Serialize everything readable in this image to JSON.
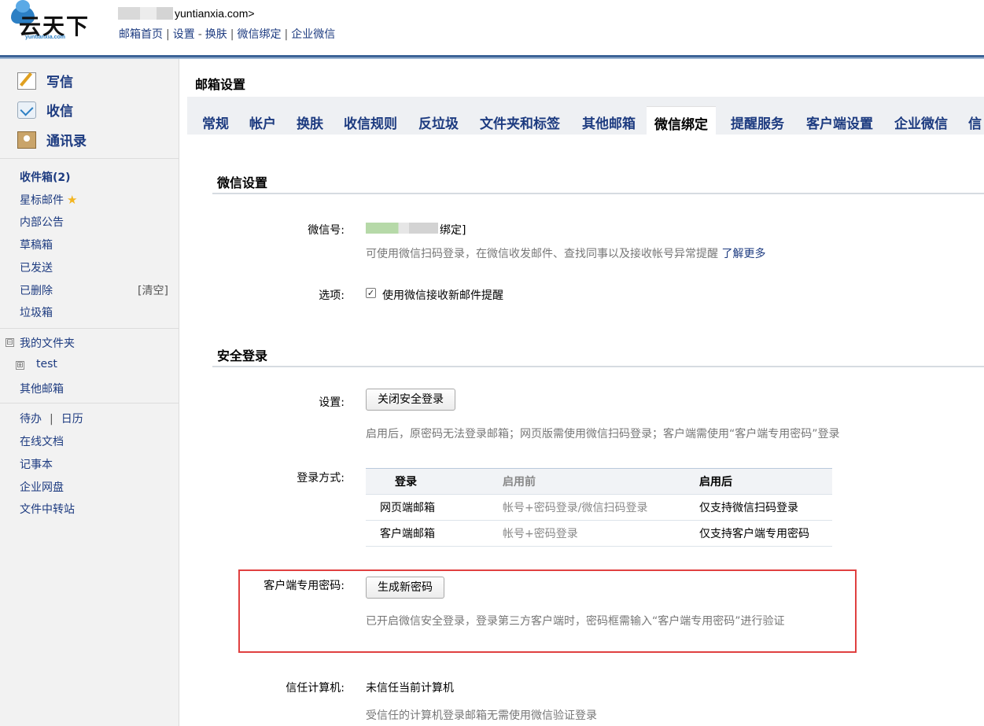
{
  "header": {
    "logo_text": "云天下",
    "logo_sub": "yuntianxia.com",
    "user_email": "yuntianxia.com>",
    "nav": [
      "邮箱首页",
      "设置",
      "换肤",
      "微信绑定",
      "企业微信"
    ],
    "nav_seps": [
      "|",
      "-",
      "|",
      "|"
    ]
  },
  "sidebar": {
    "compose": "写信",
    "receive": "收信",
    "contacts": "通讯录",
    "folders": {
      "inbox": "收件箱(2)",
      "starred": "星标邮件",
      "notice": "内部公告",
      "drafts": "草稿箱",
      "sent": "已发送",
      "deleted": "已删除",
      "clear": "[清空]",
      "spam": "垃圾箱"
    },
    "my_folders": "我的文件夹",
    "my_folders_toggle": "⊟",
    "test_folder": "test",
    "test_toggle": "⊞",
    "other_mailbox": "其他邮箱",
    "todo": "待办",
    "todo_sep": "|",
    "calendar": "日历",
    "docs": "在线文档",
    "notes": "记事本",
    "disk": "企业网盘",
    "transfer": "文件中转站"
  },
  "main": {
    "page_title": "邮箱设置",
    "tabs": [
      "常规",
      "帐户",
      "换肤",
      "收信规则",
      "反垃圾",
      "文件夹和标签",
      "其他邮箱",
      "微信绑定",
      "提醒服务",
      "客户端设置",
      "企业微信",
      "信"
    ],
    "active_tab": "微信绑定",
    "wechat": {
      "section_title": "微信设置",
      "id_label": "微信号:",
      "id_value": "绑定]",
      "id_hint": "可使用微信扫码登录，在微信收发邮件、查找同事以及接收帐号异常提醒",
      "learn_more": "了解更多",
      "option_label": "选项:",
      "option_check": "✓",
      "option_text": "使用微信接收新邮件提醒"
    },
    "security": {
      "section_title": "安全登录",
      "setting_label": "设置:",
      "close_button": "关闭安全登录",
      "setting_hint": "启用后，原密码无法登录邮箱；网页版需使用微信扫码登录；客户端需使用“客户端专用密码”登录",
      "mode_label": "登录方式:",
      "table": {
        "headers": [
          "登录",
          "启用前",
          "启用后"
        ],
        "rows": [
          [
            "网页端邮箱",
            "帐号+密码登录/微信扫码登录",
            "仅支持微信扫码登录"
          ],
          [
            "客户端邮箱",
            "帐号+密码登录",
            "仅支持客户端专用密码"
          ]
        ]
      },
      "client_pwd_label": "客户端专用密码:",
      "generate_button": "生成新密码",
      "client_pwd_hint": "已开启微信安全登录，登录第三方客户端时，密码框需输入“客户端专用密码”进行验证",
      "trusted_label": "信任计算机:",
      "trusted_value": "未信任当前计算机",
      "trusted_hint": "受信任的计算机登录邮箱无需使用微信验证登录"
    }
  }
}
